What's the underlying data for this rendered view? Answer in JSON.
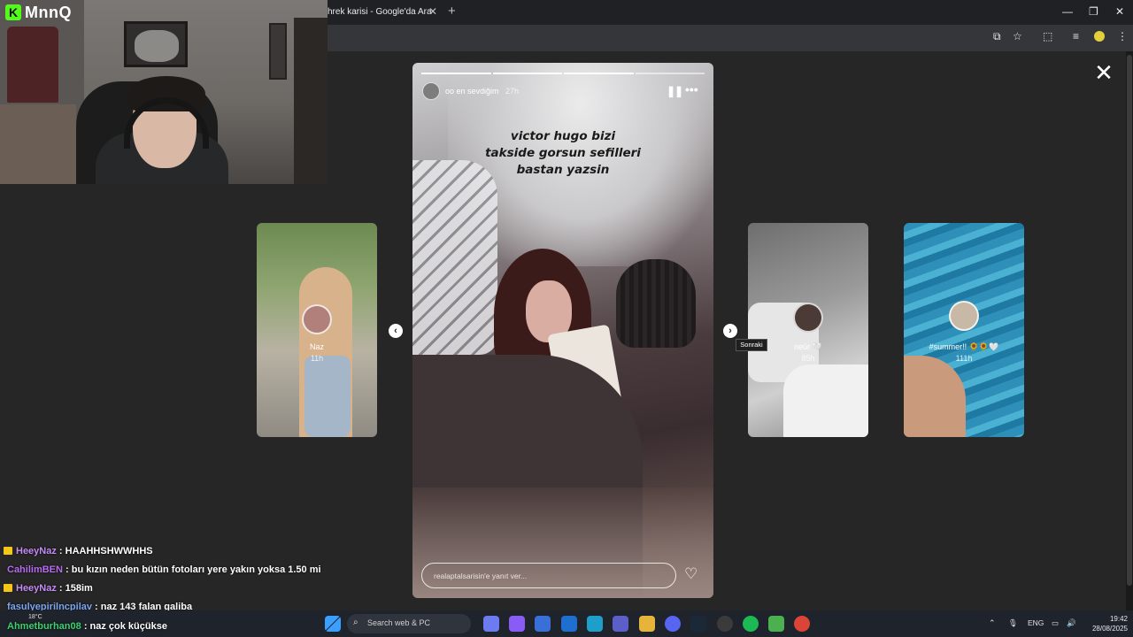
{
  "browser": {
    "tab_title": "hrek karisi - Google'da Ara",
    "tab_close": "✕",
    "new_tab": "+",
    "win_min": "—",
    "win_max": "❐",
    "win_close": "✕"
  },
  "stream": {
    "logo_letter": "K",
    "logo_text": "MnnQ"
  },
  "viewer": {
    "close": "✕",
    "main_story": {
      "username": "oo en sevdiğim",
      "time": "27h",
      "caption_lines": [
        "victor hugo bizi",
        "takside gorsun sefilleri",
        "bastan yazsin"
      ],
      "reply_placeholder": "realaptalsarisin'e yanıt ver...",
      "pause": "❚❚",
      "more": "•••",
      "heart": "♡",
      "progress": {
        "total": 4,
        "done": 3
      }
    },
    "side_stories": [
      {
        "name": "Naz",
        "time": "11h"
      },
      {
        "name": "neür 🤍",
        "time": "85h"
      },
      {
        "name": "#summer!! 🌻🌻🤍",
        "time": "111h"
      }
    ],
    "prev_btn": "‹",
    "next_btn": "›",
    "tooltip": "Sonraki"
  },
  "chat": [
    {
      "user": "HeeyNaz",
      "color": "#c48cf5",
      "badge": true,
      "message": ": HAAHHSHWWHHS"
    },
    {
      "user": "CahilimBEN",
      "color": "#b86cf0",
      "badge": false,
      "message": ": bu kızın neden bütün fotoları yere yakın yoksa 1.50 mi"
    },
    {
      "user": "HeeyNaz",
      "color": "#c48cf5",
      "badge": true,
      "message": ": 158im"
    },
    {
      "user": "fasulyepirilncpilav",
      "color": "#7aa6f5",
      "badge": false,
      "message": ": naz 143 falan galiba"
    },
    {
      "user": "Ahmetburhan08",
      "color": "#3bd16f",
      "badge": false,
      "message": ": naz çok küçükse"
    }
  ],
  "taskbar": {
    "search_placeholder": "Search web & PC",
    "weather": "18°C",
    "language": "ENG",
    "time": "19:42",
    "date": "28/08/2025"
  }
}
